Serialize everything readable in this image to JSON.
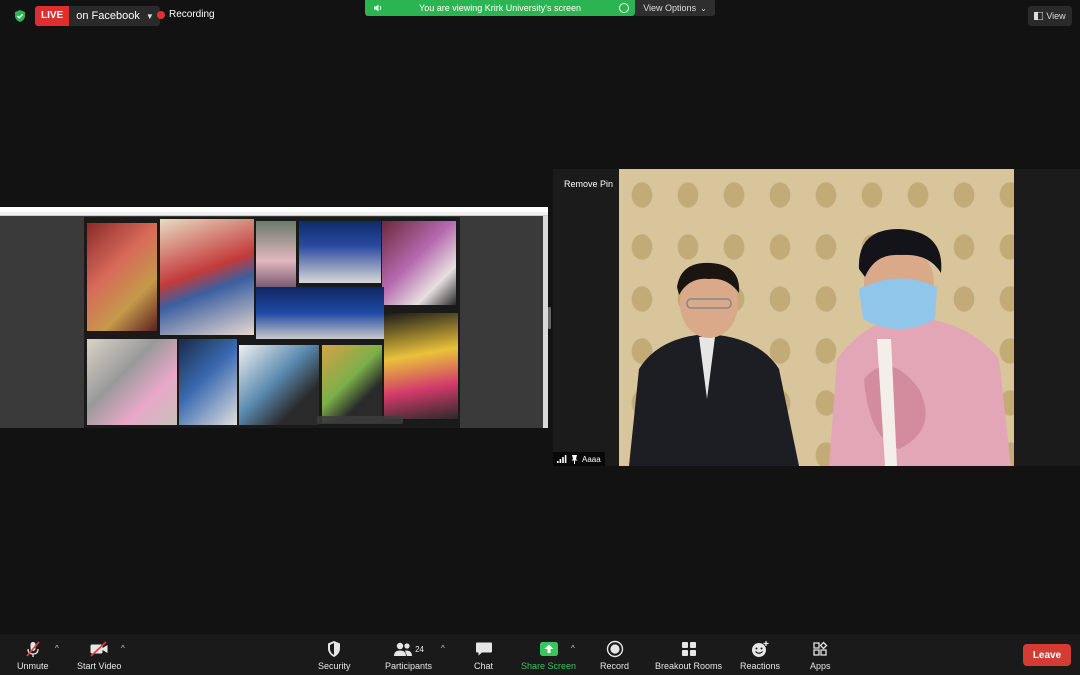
{
  "topbar": {
    "live_badge": "LIVE",
    "live_target": "on Facebook",
    "recording": "Recording",
    "banner": "You are viewing Krirk University's screen",
    "view_options": "View Options",
    "view": "View"
  },
  "video": {
    "remove_pin": "Remove Pin",
    "participant_name": "Aaaa"
  },
  "toolbar": {
    "unmute": "Unmute",
    "start_video": "Start Video",
    "security": "Security",
    "participants": "Participants",
    "participants_count": "24",
    "chat": "Chat",
    "share_screen": "Share Screen",
    "record": "Record",
    "breakout_rooms": "Breakout Rooms",
    "reactions": "Reactions",
    "apps": "Apps",
    "leave": "Leave"
  },
  "colors": {
    "live": "#e02d2d",
    "banner": "#2cb352",
    "share_green": "#37c65c",
    "leave": "#d33b33"
  }
}
